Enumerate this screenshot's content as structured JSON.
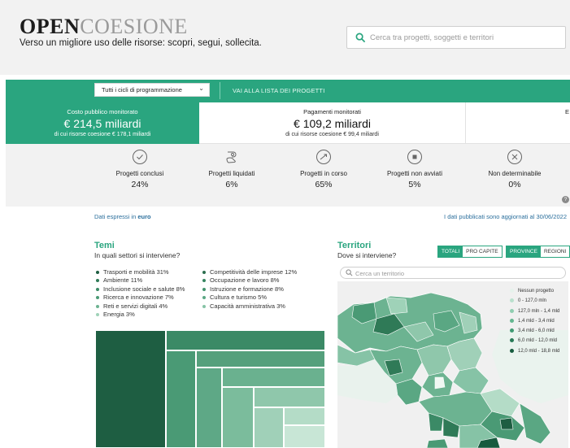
{
  "header": {
    "logo_open": "OPEN",
    "logo_coesione": "COESIONE",
    "tagline": "Verso un migliore uso delle risorse: scopri, segui, sollecita.",
    "search_placeholder": "Cerca tra progetti, soggetti e territori"
  },
  "toolbar": {
    "cycle_select": "Tutti i cicli di programmazione",
    "projects_link": "VAI ALLA LISTA DEI PROGETTI"
  },
  "metrics": [
    {
      "label": "Costo pubblico monitorato",
      "value": "€ 214,5 miliardi",
      "sub": "di cui risorse coesione € 178,1 miliardi"
    },
    {
      "label": "Pagamenti monitorati",
      "value": "€ 109,2 miliardi",
      "sub": "di cui risorse coesione € 99,4 miliardi"
    },
    {
      "label": "E"
    }
  ],
  "statuses": [
    {
      "icon": "check-circle-icon",
      "label": "Progetti conclusi",
      "pct": "24%"
    },
    {
      "icon": "money-hand-icon",
      "label": "Progetti liquidati",
      "pct": "6%"
    },
    {
      "icon": "progress-circle-icon",
      "label": "Progetti in corso",
      "pct": "65%"
    },
    {
      "icon": "stop-circle-icon",
      "label": "Progetti non avviati",
      "pct": "5%"
    },
    {
      "icon": "x-circle-icon",
      "label": "Non determinabile",
      "pct": "0%"
    }
  ],
  "notes": {
    "currency_prefix": "Dati espressi in",
    "currency": "euro",
    "updated": "I dati pubblicati sono aggiornati al 30/06/2022"
  },
  "temi": {
    "title": "Temi",
    "subtitle": "In quali settori si interviene?",
    "legend_left": [
      {
        "label": "Trasporti e mobilità 31%",
        "color": "#1e5e42"
      },
      {
        "label": "Ambiente 11%",
        "color": "#2f7a57"
      },
      {
        "label": "Inclusione sociale e salute 8%",
        "color": "#3b8a66"
      },
      {
        "label": "Ricerca e innovazione 7%",
        "color": "#4a9a75"
      },
      {
        "label": "Reti e servizi digitali 4%",
        "color": "#6cb391"
      },
      {
        "label": "Energia 3%",
        "color": "#9fd2b8"
      }
    ],
    "legend_right": [
      {
        "label": "Competitività delle imprese 12%",
        "color": "#2b6e4e"
      },
      {
        "label": "Occupazione e lavoro 8%",
        "color": "#35845f"
      },
      {
        "label": "Istruzione e formazione 8%",
        "color": "#43936d"
      },
      {
        "label": "Cultura e turismo 5%",
        "color": "#5aa783"
      },
      {
        "label": "Capacità amministrativa 3%",
        "color": "#86c3a6"
      }
    ]
  },
  "territori": {
    "title": "Territori",
    "subtitle": "Dove si interviene?",
    "toggle_totali": "TOTALI",
    "toggle_procapite": "PRO CAPITE",
    "toggle_province": "PROVINCE",
    "toggle_regioni": "REGIONI",
    "search_placeholder": "Cerca un territorio",
    "legend": [
      {
        "label": "Nessun progetto",
        "color": "#e6f2ec"
      },
      {
        "label": "0 - 127,0 mln",
        "color": "#b9e0cd"
      },
      {
        "label": "127,0 mln - 1,4 mld",
        "color": "#8fcdb0"
      },
      {
        "label": "1,4 mld - 3,4 mld",
        "color": "#63b58f"
      },
      {
        "label": "3,4 mld - 6,0 mld",
        "color": "#3f9a72"
      },
      {
        "label": "6,0 mld - 12,0 mld",
        "color": "#287a57"
      },
      {
        "label": "12,0 mld - 18,8 mld",
        "color": "#165b3e"
      }
    ]
  },
  "colors": {
    "accent": "#2aa57f",
    "link": "#2b6f9c"
  }
}
